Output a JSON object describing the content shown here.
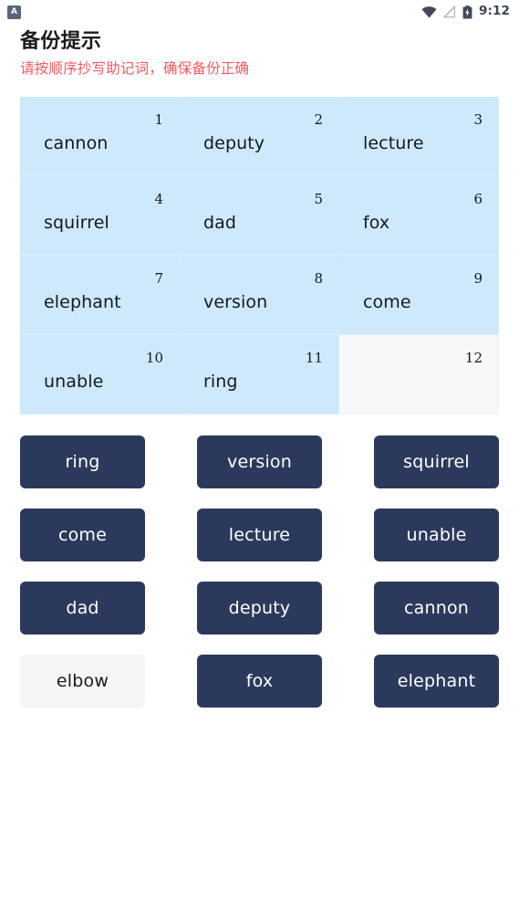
{
  "status_bar": {
    "app_badge_letter": "A",
    "icons": [
      "wifi-icon",
      "signal-off-icon",
      "battery-charging-icon"
    ],
    "time": "9:12"
  },
  "header": {
    "title": "备份提示",
    "subtitle": "请按顺序抄写助记词，确保备份正确",
    "subtitle_color": "#f8595e"
  },
  "mnemonic_grid": {
    "cells": [
      {
        "index": "1",
        "word": "cannon",
        "filled": true
      },
      {
        "index": "2",
        "word": "deputy",
        "filled": true
      },
      {
        "index": "3",
        "word": "lecture",
        "filled": true
      },
      {
        "index": "4",
        "word": "squirrel",
        "filled": true
      },
      {
        "index": "5",
        "word": "dad",
        "filled": true
      },
      {
        "index": "6",
        "word": "fox",
        "filled": true
      },
      {
        "index": "7",
        "word": "elephant",
        "filled": true
      },
      {
        "index": "8",
        "word": "version",
        "filled": true
      },
      {
        "index": "9",
        "word": "come",
        "filled": true
      },
      {
        "index": "10",
        "word": "unable",
        "filled": true
      },
      {
        "index": "11",
        "word": "ring",
        "filled": true
      },
      {
        "index": "12",
        "word": "",
        "filled": false
      }
    ],
    "filled_bg": "#cde9fb",
    "empty_bg": "#f7f8f9"
  },
  "word_bank": {
    "accent": "#2b3a5c",
    "used_bg": "#f5f5f6",
    "words": [
      {
        "label": "ring",
        "used": false
      },
      {
        "label": "version",
        "used": false
      },
      {
        "label": "squirrel",
        "used": false
      },
      {
        "label": "come",
        "used": false
      },
      {
        "label": "lecture",
        "used": false
      },
      {
        "label": "unable",
        "used": false
      },
      {
        "label": "dad",
        "used": false
      },
      {
        "label": "deputy",
        "used": false
      },
      {
        "label": "cannon",
        "used": false
      },
      {
        "label": "elbow",
        "used": true
      },
      {
        "label": "fox",
        "used": false
      },
      {
        "label": "elephant",
        "used": false
      }
    ]
  }
}
